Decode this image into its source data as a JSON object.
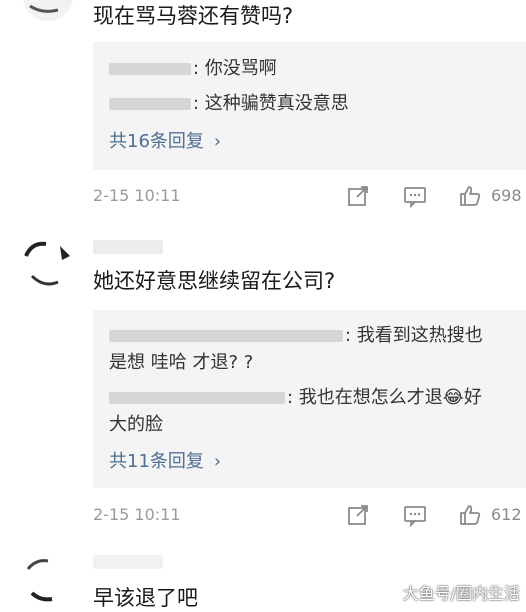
{
  "comments": [
    {
      "text": "现在骂马蓉还有赞吗?",
      "replies": [
        {
          "name_suffix": ":",
          "text": " 你没骂啊"
        },
        {
          "name_suffix": ":",
          "text": " 这种骗赞真没意思"
        }
      ],
      "more_label": "共16条回复",
      "time": "2-15 10:11",
      "likes": "698"
    },
    {
      "text": "她还好意思继续留在公司?",
      "replies": [
        {
          "name_suffix": ":",
          "text": " 我看到这热搜也",
          "cont": "是想 哇哈 才退? ?"
        },
        {
          "name_suffix": ":",
          "text": " 我也在想怎么才退😂好",
          "cont": "大的脸"
        }
      ],
      "more_label": "共11条回复",
      "time": "2-15 10:11",
      "likes": "612"
    },
    {
      "text": "早该退了吧"
    }
  ],
  "icons": {
    "share": "share-icon",
    "comment": "comment-icon",
    "like": "thumbs-up-icon",
    "more": "chevron-right-icon"
  },
  "watermark": "大鱼号/圈内生活",
  "colors": {
    "link": "#4e6f96",
    "reply_bg": "#f4f4f4",
    "meta": "#9a9a9a"
  }
}
